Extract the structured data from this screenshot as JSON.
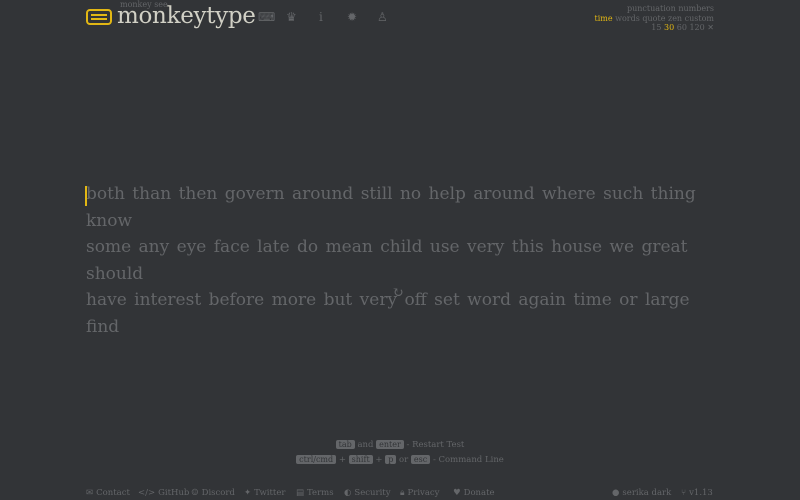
{
  "header": {
    "subtitle": "monkey see",
    "brand": "monkeytype",
    "nav": [
      "keyboard-icon",
      "crown-icon",
      "info-icon",
      "gear-icon",
      "user-icon"
    ]
  },
  "config": {
    "row1": [
      "punctuation",
      "numbers"
    ],
    "modes": [
      "time",
      "words",
      "quote",
      "zen",
      "custom"
    ],
    "active_mode": "time",
    "durations": [
      "15",
      "30",
      "60",
      "120"
    ],
    "active_duration": "30"
  },
  "test": {
    "lines": [
      "both than then govern around still no help around where such thing know",
      "some any eye face late do mean child use very this house we great should",
      "have interest before more but very off set word again time or large find"
    ]
  },
  "hints": {
    "k_tab": "tab",
    "and": "and",
    "k_enter": "enter",
    "restart": "- Restart Test",
    "k_ctrl": "ctrl/cmd",
    "plus": "+",
    "k_shift": "shift",
    "k_p": "p",
    "or": "or",
    "k_esc": "esc",
    "cmdline": "- Command Line"
  },
  "footer": {
    "links": [
      "Contact",
      "GitHub",
      "Discord",
      "Twitter",
      "Terms",
      "Security",
      "Privacy",
      "Donate"
    ],
    "theme": "serika dark",
    "version": "v1.13"
  }
}
